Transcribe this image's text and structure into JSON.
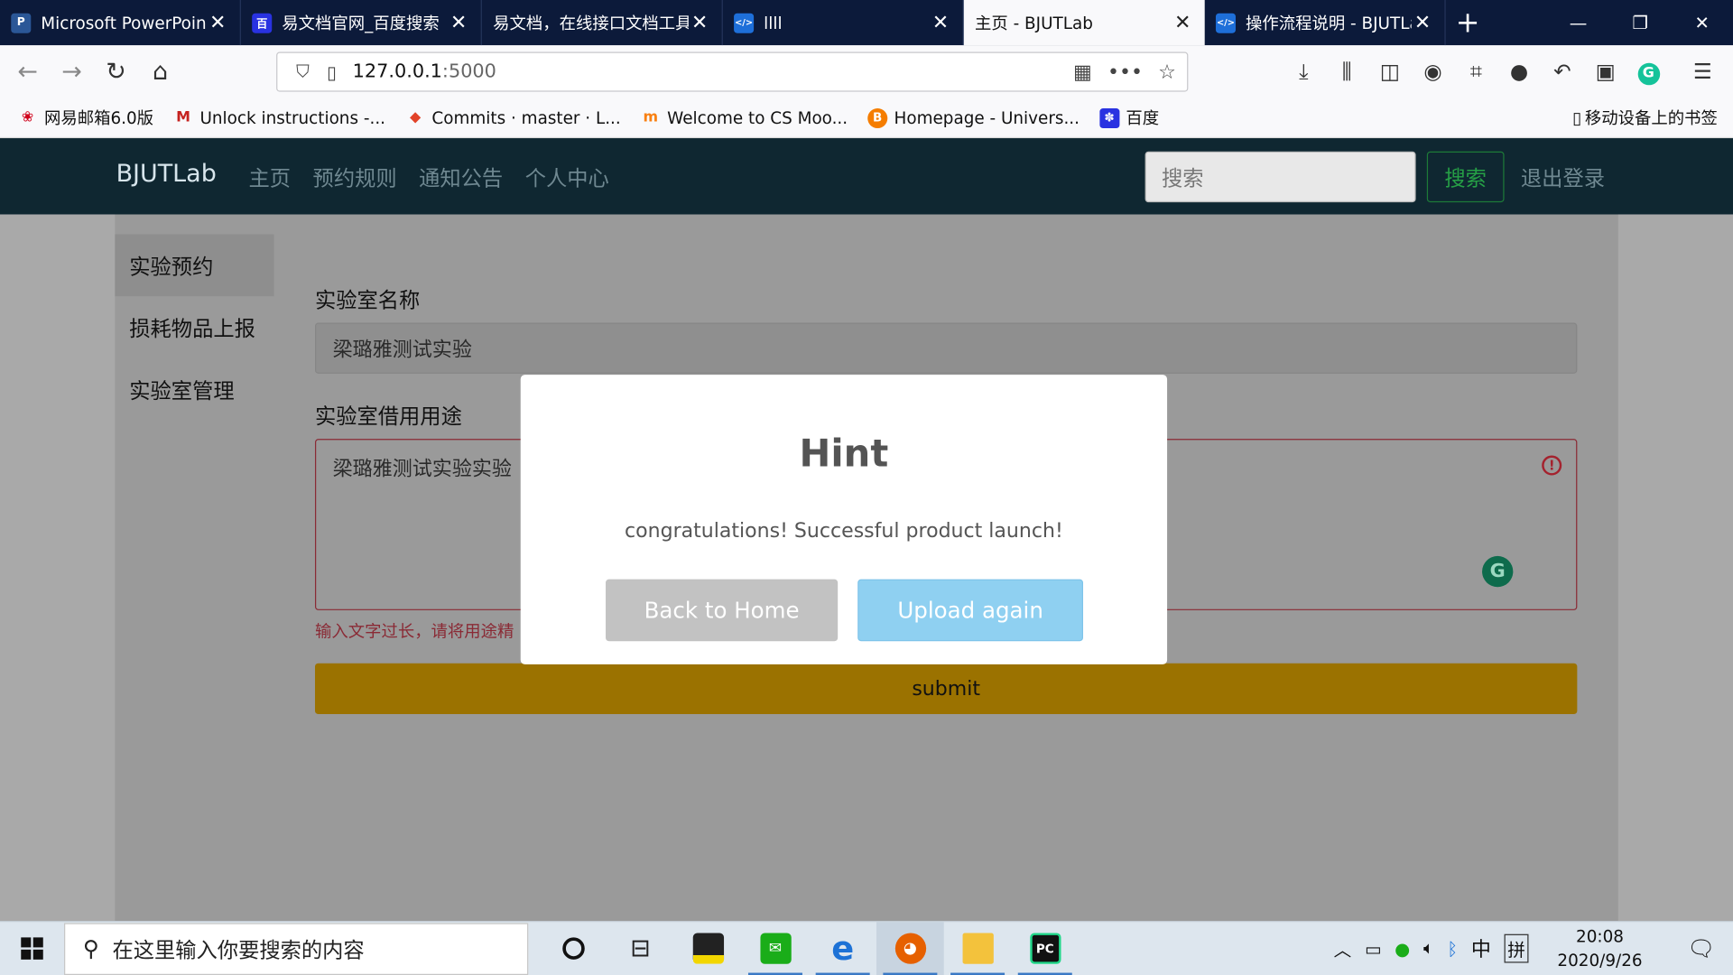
{
  "browser": {
    "tabs": [
      {
        "title": "Microsoft PowerPoint",
        "favicon": "powerpoint-icon",
        "color": "#2b5797",
        "glyph": "P"
      },
      {
        "title": "易文档官网_百度搜索",
        "favicon": "baidu-icon",
        "color": "#2932e1",
        "glyph": "百"
      },
      {
        "title": "易文档，在线接口文档工具",
        "favicon": "none",
        "color": "",
        "glyph": ""
      },
      {
        "title": "llll",
        "favicon": "doc-icon",
        "color": "#1e6fd9",
        "glyph": "</>"
      },
      {
        "title": "主页 - BJUTLab",
        "favicon": "none",
        "color": "",
        "glyph": "",
        "active": true
      },
      {
        "title": "操作流程说明 - BJUTLab",
        "favicon": "doc-icon",
        "color": "#1e6fd9",
        "glyph": "</>"
      }
    ],
    "new_tab": "+",
    "window_controls": {
      "minimize": "—",
      "restore": "❐",
      "close": "✕"
    },
    "url": {
      "host": "127.0.0.1",
      "port": ":5000"
    },
    "bookmarks": [
      {
        "label": "网易邮箱6.0版",
        "icon": "netease-mail-icon",
        "color": "#d0021b",
        "glyph": "❀"
      },
      {
        "label": "Unlock instructions -...",
        "icon": "gmail-icon",
        "color": "#c5221f",
        "glyph": "M"
      },
      {
        "label": "Commits · master · L...",
        "icon": "gitlab-icon",
        "color": "#e24329",
        "glyph": "◆"
      },
      {
        "label": "Welcome to CS Moo...",
        "icon": "moodle-icon",
        "color": "#f98012",
        "glyph": "m"
      },
      {
        "label": "Homepage - Univers...",
        "icon": "blogger-icon",
        "color": "#f57d00",
        "glyph": "B"
      },
      {
        "label": "百度",
        "icon": "baidu-paw-icon",
        "color": "#2932e1",
        "glyph": "🐾"
      }
    ],
    "mobile_bookmarks": "移动设备上的书签"
  },
  "site": {
    "brand": "BJUTLab",
    "nav": [
      "主页",
      "预约规则",
      "通知公告",
      "个人中心"
    ],
    "search_placeholder": "搜索",
    "search_button": "搜索",
    "logout": "退出登录"
  },
  "sidebar": {
    "items": [
      {
        "label": "实验预约",
        "active": true
      },
      {
        "label": "损耗物品上报"
      },
      {
        "label": "实验室管理"
      }
    ]
  },
  "form": {
    "lab_name_label": "实验室名称",
    "lab_name_value": "梁璐雅测试实验",
    "purpose_label": "实验室借用用途",
    "purpose_value": "梁璐雅测试实验实验",
    "error": "输入文字过长，请将用途精",
    "submit": "submit"
  },
  "modal": {
    "title": "Hint",
    "message": "congratulations! Successful product launch!",
    "back_button": "Back to Home",
    "again_button": "Upload again"
  },
  "taskbar": {
    "search_placeholder": "在这里输入你要搜索的内容",
    "tray_ime": "中",
    "tray_ime2": "拼",
    "time": "20:08",
    "date": "2020/9/26"
  }
}
